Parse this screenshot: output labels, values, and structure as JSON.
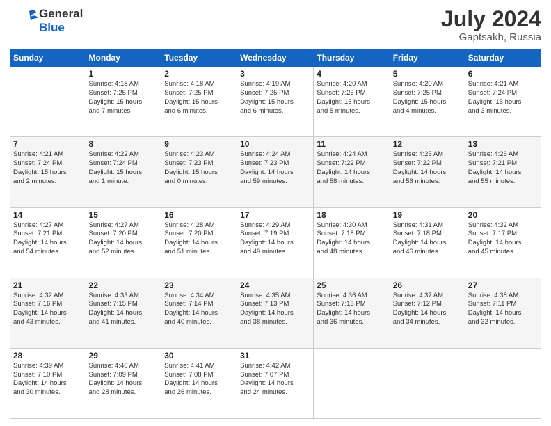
{
  "header": {
    "logo_line1": "General",
    "logo_line2": "Blue",
    "month_title": "July 2024",
    "subtitle": "Gaptsakh, Russia"
  },
  "days_of_week": [
    "Sunday",
    "Monday",
    "Tuesday",
    "Wednesday",
    "Thursday",
    "Friday",
    "Saturday"
  ],
  "weeks": [
    [
      {
        "day": "",
        "info": ""
      },
      {
        "day": "1",
        "info": "Sunrise: 4:18 AM\nSunset: 7:25 PM\nDaylight: 15 hours\nand 7 minutes."
      },
      {
        "day": "2",
        "info": "Sunrise: 4:18 AM\nSunset: 7:25 PM\nDaylight: 15 hours\nand 6 minutes."
      },
      {
        "day": "3",
        "info": "Sunrise: 4:19 AM\nSunset: 7:25 PM\nDaylight: 15 hours\nand 6 minutes."
      },
      {
        "day": "4",
        "info": "Sunrise: 4:20 AM\nSunset: 7:25 PM\nDaylight: 15 hours\nand 5 minutes."
      },
      {
        "day": "5",
        "info": "Sunrise: 4:20 AM\nSunset: 7:25 PM\nDaylight: 15 hours\nand 4 minutes."
      },
      {
        "day": "6",
        "info": "Sunrise: 4:21 AM\nSunset: 7:24 PM\nDaylight: 15 hours\nand 3 minutes."
      }
    ],
    [
      {
        "day": "7",
        "info": "Sunrise: 4:21 AM\nSunset: 7:24 PM\nDaylight: 15 hours\nand 2 minutes."
      },
      {
        "day": "8",
        "info": "Sunrise: 4:22 AM\nSunset: 7:24 PM\nDaylight: 15 hours\nand 1 minute."
      },
      {
        "day": "9",
        "info": "Sunrise: 4:23 AM\nSunset: 7:23 PM\nDaylight: 15 hours\nand 0 minutes."
      },
      {
        "day": "10",
        "info": "Sunrise: 4:24 AM\nSunset: 7:23 PM\nDaylight: 14 hours\nand 59 minutes."
      },
      {
        "day": "11",
        "info": "Sunrise: 4:24 AM\nSunset: 7:22 PM\nDaylight: 14 hours\nand 58 minutes."
      },
      {
        "day": "12",
        "info": "Sunrise: 4:25 AM\nSunset: 7:22 PM\nDaylight: 14 hours\nand 56 minutes."
      },
      {
        "day": "13",
        "info": "Sunrise: 4:26 AM\nSunset: 7:21 PM\nDaylight: 14 hours\nand 55 minutes."
      }
    ],
    [
      {
        "day": "14",
        "info": "Sunrise: 4:27 AM\nSunset: 7:21 PM\nDaylight: 14 hours\nand 54 minutes."
      },
      {
        "day": "15",
        "info": "Sunrise: 4:27 AM\nSunset: 7:20 PM\nDaylight: 14 hours\nand 52 minutes."
      },
      {
        "day": "16",
        "info": "Sunrise: 4:28 AM\nSunset: 7:20 PM\nDaylight: 14 hours\nand 51 minutes."
      },
      {
        "day": "17",
        "info": "Sunrise: 4:29 AM\nSunset: 7:19 PM\nDaylight: 14 hours\nand 49 minutes."
      },
      {
        "day": "18",
        "info": "Sunrise: 4:30 AM\nSunset: 7:18 PM\nDaylight: 14 hours\nand 48 minutes."
      },
      {
        "day": "19",
        "info": "Sunrise: 4:31 AM\nSunset: 7:18 PM\nDaylight: 14 hours\nand 46 minutes."
      },
      {
        "day": "20",
        "info": "Sunrise: 4:32 AM\nSunset: 7:17 PM\nDaylight: 14 hours\nand 45 minutes."
      }
    ],
    [
      {
        "day": "21",
        "info": "Sunrise: 4:32 AM\nSunset: 7:16 PM\nDaylight: 14 hours\nand 43 minutes."
      },
      {
        "day": "22",
        "info": "Sunrise: 4:33 AM\nSunset: 7:15 PM\nDaylight: 14 hours\nand 41 minutes."
      },
      {
        "day": "23",
        "info": "Sunrise: 4:34 AM\nSunset: 7:14 PM\nDaylight: 14 hours\nand 40 minutes."
      },
      {
        "day": "24",
        "info": "Sunrise: 4:35 AM\nSunset: 7:13 PM\nDaylight: 14 hours\nand 38 minutes."
      },
      {
        "day": "25",
        "info": "Sunrise: 4:36 AM\nSunset: 7:13 PM\nDaylight: 14 hours\nand 36 minutes."
      },
      {
        "day": "26",
        "info": "Sunrise: 4:37 AM\nSunset: 7:12 PM\nDaylight: 14 hours\nand 34 minutes."
      },
      {
        "day": "27",
        "info": "Sunrise: 4:38 AM\nSunset: 7:11 PM\nDaylight: 14 hours\nand 32 minutes."
      }
    ],
    [
      {
        "day": "28",
        "info": "Sunrise: 4:39 AM\nSunset: 7:10 PM\nDaylight: 14 hours\nand 30 minutes."
      },
      {
        "day": "29",
        "info": "Sunrise: 4:40 AM\nSunset: 7:09 PM\nDaylight: 14 hours\nand 28 minutes."
      },
      {
        "day": "30",
        "info": "Sunrise: 4:41 AM\nSunset: 7:08 PM\nDaylight: 14 hours\nand 26 minutes."
      },
      {
        "day": "31",
        "info": "Sunrise: 4:42 AM\nSunset: 7:07 PM\nDaylight: 14 hours\nand 24 minutes."
      },
      {
        "day": "",
        "info": ""
      },
      {
        "day": "",
        "info": ""
      },
      {
        "day": "",
        "info": ""
      }
    ]
  ]
}
